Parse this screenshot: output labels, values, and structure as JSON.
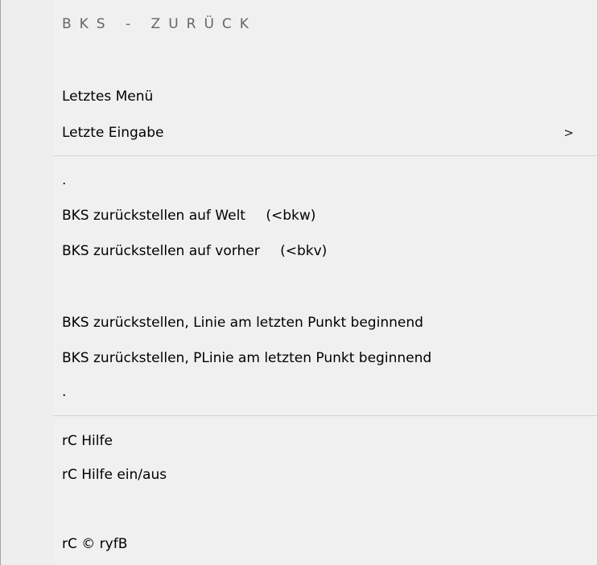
{
  "menu": {
    "title": "BKS - ZURÜCK",
    "items": [
      {
        "label": "Letztes Menü",
        "suffix": ""
      },
      {
        "label": "Letzte Eingabe",
        "suffix": "",
        "submenu_arrow": ">"
      },
      {
        "label": ".",
        "suffix": ""
      },
      {
        "label": "BKS zurückstellen auf Welt",
        "suffix": "(<bkw)"
      },
      {
        "label": "BKS zurückstellen auf vorher",
        "suffix": "(<bkv)"
      },
      {
        "label": "BKS zurückstellen, Linie am letzten Punkt beginnend",
        "suffix": ""
      },
      {
        "label": "BKS zurückstellen, PLinie am letzten Punkt beginnend",
        "suffix": ""
      },
      {
        "label": ".",
        "suffix": ""
      },
      {
        "label": "rC Hilfe",
        "suffix": ""
      },
      {
        "label": "rC Hilfe ein/aus",
        "suffix": ""
      },
      {
        "label": "rC © ryfB",
        "suffix": ""
      }
    ]
  }
}
